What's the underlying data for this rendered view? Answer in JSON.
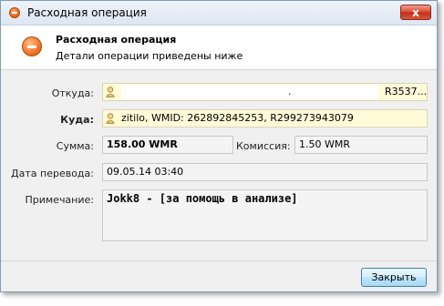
{
  "window": {
    "title": "Расходная операция",
    "close_label": "x"
  },
  "header": {
    "title": "Расходная операция",
    "subtitle": "Детали операции приведены ниже"
  },
  "form": {
    "from_label": "Откуда:",
    "from_value_suffix": "R3537...",
    "from_value_dot": ".",
    "to_label": "Куда:",
    "to_value": "zitilo, WMID: 262892845253, R299273943079",
    "sum_label": "Сумма:",
    "sum_value": "158.00 WMR",
    "commission_label": "Комиссия:",
    "commission_value": "1.50 WMR",
    "date_label": "Дата перевода:",
    "date_value": "09.05.14 03:40",
    "note_label": "Примечание:",
    "note_value": "Jokk8 - [за помощь в анализе]"
  },
  "footer": {
    "close_button": "Закрыть"
  },
  "colors": {
    "accent_orange": "#e35d10",
    "highlight_field": "#fffbd9",
    "button_border": "#3c7fb1"
  }
}
